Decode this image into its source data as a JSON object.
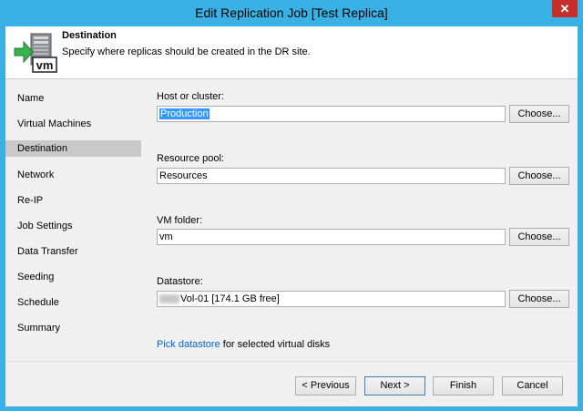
{
  "window": {
    "title": "Edit Replication Job [Test Replica]",
    "close_glyph": "✕"
  },
  "header": {
    "icon": "vm-server-arrow-icon",
    "icon_text": "vm",
    "title": "Destination",
    "description": "Specify where replicas should be created in the DR site."
  },
  "sidebar": {
    "items": [
      {
        "label": "Name"
      },
      {
        "label": "Virtual Machines"
      },
      {
        "label": "Destination",
        "active": true
      },
      {
        "label": "Network"
      },
      {
        "label": "Re-IP"
      },
      {
        "label": "Job Settings"
      },
      {
        "label": "Data Transfer"
      },
      {
        "label": "Seeding"
      },
      {
        "label": "Schedule"
      },
      {
        "label": "Summary"
      }
    ]
  },
  "main": {
    "host": {
      "label": "Host or cluster:",
      "value": "Production",
      "button": "Choose..."
    },
    "pool": {
      "label": "Resource pool:",
      "value": "Resources",
      "button": "Choose..."
    },
    "folder": {
      "label": "VM folder:",
      "value": "vm",
      "button": "Choose..."
    },
    "datastore": {
      "label": "Datastore:",
      "value": "Vol-01 [174.1 GB free]",
      "button": "Choose..."
    },
    "pick_link": "Pick datastore",
    "pick_text": " for selected virtual disks"
  },
  "footer": {
    "previous": "< Previous",
    "next": "Next >",
    "finish": "Finish",
    "cancel": "Cancel"
  }
}
